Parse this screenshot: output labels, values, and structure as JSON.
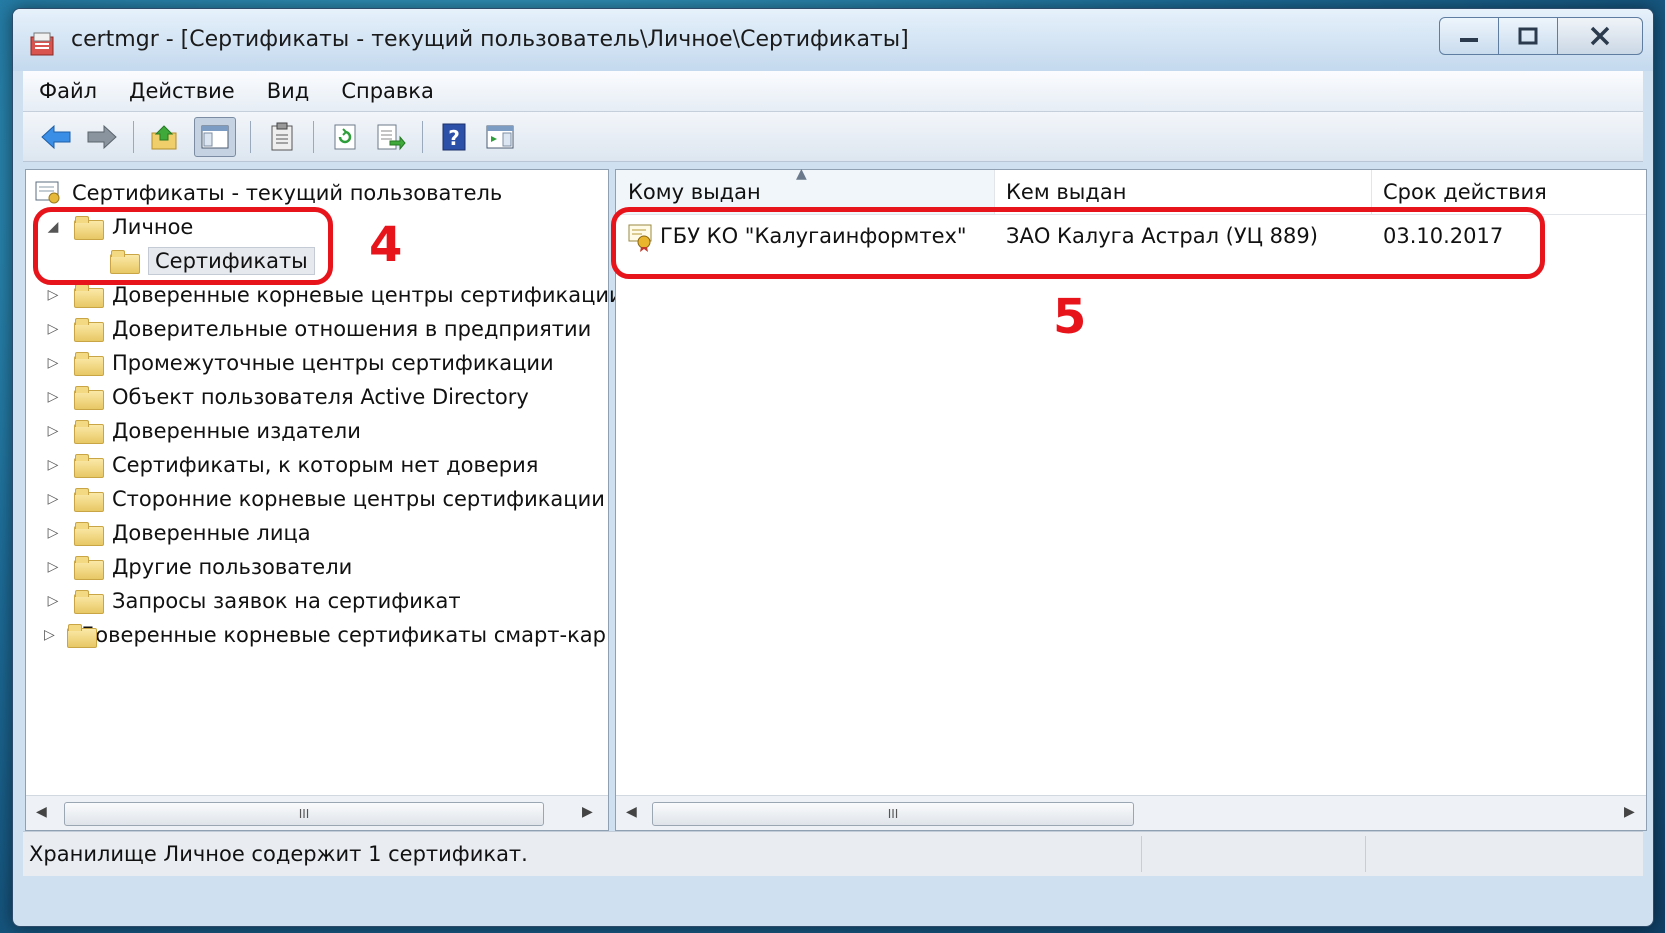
{
  "window": {
    "title": "certmgr - [Сертификаты - текущий пользователь\\Личное\\Сертификаты]",
    "controls": {
      "minimize": "—",
      "maximize": "□",
      "close": "✕"
    }
  },
  "menu": [
    "Файл",
    "Действие",
    "Вид",
    "Справка"
  ],
  "toolbar": {
    "icons": [
      "back-arrow-icon",
      "forward-arrow-icon",
      "up-folder-icon",
      "show-hide-tree-icon",
      "clipboard-icon",
      "refresh-icon",
      "export-list-icon",
      "help-icon",
      "action-pane-icon"
    ]
  },
  "tree": {
    "root": "Сертификаты - текущий пользователь",
    "items": [
      {
        "label": "Личное",
        "expanded": true,
        "expander": "◢"
      },
      {
        "label": "Сертификаты",
        "selected": true
      },
      {
        "label": "Доверенные корневые центры сертификации",
        "expander": "▷"
      },
      {
        "label": "Доверительные отношения в предприятии",
        "expander": "▷"
      },
      {
        "label": "Промежуточные центры сертификации",
        "expander": "▷"
      },
      {
        "label": "Объект пользователя Active Directory",
        "expander": "▷"
      },
      {
        "label": "Доверенные издатели",
        "expander": "▷"
      },
      {
        "label": "Сертификаты, к которым нет доверия",
        "expander": "▷"
      },
      {
        "label": "Сторонние корневые центры сертификации",
        "expander": "▷"
      },
      {
        "label": "Доверенные лица",
        "expander": "▷"
      },
      {
        "label": "Другие пользователи",
        "expander": "▷"
      },
      {
        "label": "Запросы заявок на сертификат",
        "expander": "▷"
      },
      {
        "label": "Доверенные корневые сертификаты смарт-кар",
        "expander": "▷"
      }
    ]
  },
  "list": {
    "columns": [
      "Кому выдан",
      "Кем выдан",
      "Срок действия"
    ],
    "rows": [
      {
        "issued_to": "ГБУ КО \"Калугаинформтех\"",
        "issued_by": "ЗАО Калуга Астрал (УЦ 889)",
        "expires": "03.10.2017"
      }
    ]
  },
  "scrollbar": {
    "left_arrow": "◀",
    "right_arrow": "▶",
    "grip": "III"
  },
  "status": {
    "text": "Хранилище Личное содержит 1 сертификат."
  },
  "annotations": {
    "label_4": "4",
    "label_5": "5",
    "color": "#e8141c"
  }
}
